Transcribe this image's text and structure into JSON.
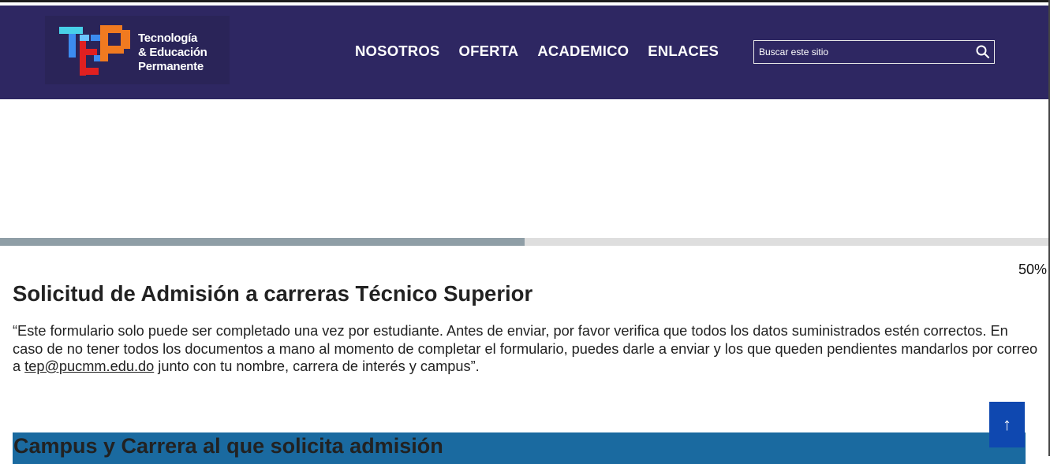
{
  "header": {
    "logo": {
      "mark_text": "TEP",
      "lines": [
        "Tecnología",
        "& Educación",
        "Permanente"
      ],
      "colors": {
        "blue": "#3c8cf0",
        "light_blue": "#6cc3ff",
        "red": "#e02020",
        "orange": "#f07a20",
        "cyan": "#48d0e8"
      }
    },
    "nav": [
      {
        "label": "NOSOTROS"
      },
      {
        "label": "OFERTA"
      },
      {
        "label": "ACADEMICO"
      },
      {
        "label": "ENLACES"
      }
    ],
    "search": {
      "placeholder": "Buscar este sitio",
      "icon": "search-icon"
    }
  },
  "progress": {
    "value": 0.5,
    "label": "50%"
  },
  "form": {
    "title": "Solicitud de Admisión a carreras Técnico Superior",
    "intro_part1": "“Este formulario solo puede ser completado una vez por estudiante. Antes de enviar, por favor verifica que todos los datos suministrados estén correctos. En caso de no tener todos los documentos a mano al momento de completar el formulario, puedes darle a enviar y los que queden pendientes mandarlos por correo a ",
    "intro_email": "tep@pucmm.edu.do",
    "intro_part2": " junto con tu nombre, carrera de interés y campus”.",
    "section_title": "Campus y Carrera al que solicita admisión"
  },
  "back_to_top": {
    "label": "↑",
    "icon": "arrow-up-icon"
  },
  "colors": {
    "header_bg": "#2e2762",
    "section_bar": "#1a6aa0",
    "back_to_top": "#0f48b0",
    "progress_fill": "#8f9ea6",
    "progress_track": "#dedede"
  }
}
